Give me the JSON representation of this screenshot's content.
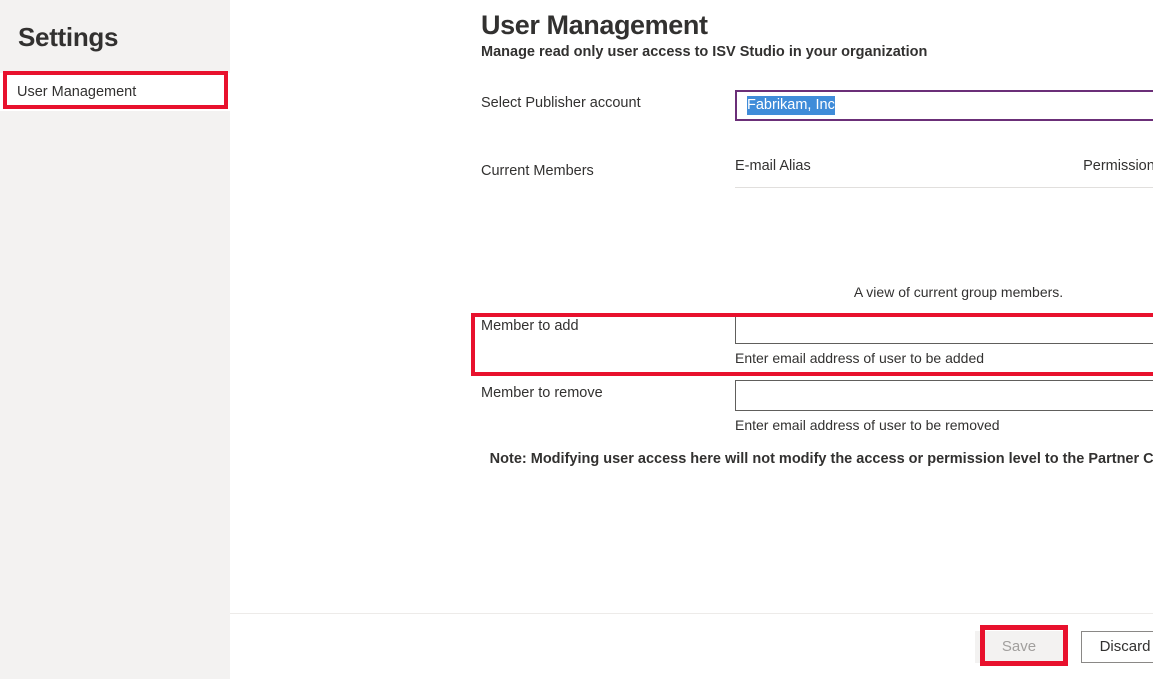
{
  "sidebar": {
    "title": "Settings",
    "items": [
      {
        "label": "User Management",
        "selected": true
      }
    ]
  },
  "header": {
    "title": "User Management",
    "subtitle": "Manage read only user access to ISV Studio in your organization",
    "close_icon": "close-icon"
  },
  "form": {
    "publisher": {
      "label": "Select Publisher account",
      "value": "Fabrikam, Inc",
      "chevron_icon": "chevron-down-icon"
    },
    "members": {
      "label": "Current Members",
      "columns": [
        "E-mail Alias",
        "Permissions"
      ],
      "rows": [],
      "caption": "A view of current group members."
    },
    "member_to_add": {
      "label": "Member to add",
      "value": "",
      "placeholder": "",
      "helper": "Enter email address of user to be added"
    },
    "member_to_remove": {
      "label": "Member to remove",
      "value": "",
      "placeholder": "",
      "helper": "Enter email address of user to be removed"
    },
    "note": "Note: Modifying user access here will not modify the access or permission level to the Partner Center."
  },
  "footer": {
    "save_label": "Save",
    "discard_label": "Discard"
  },
  "colors": {
    "annotation_red": "#e8112d",
    "accent_purple": "#6b2f78",
    "selection_blue": "#3f8cd9",
    "sidebar_bg": "#f3f2f1"
  }
}
